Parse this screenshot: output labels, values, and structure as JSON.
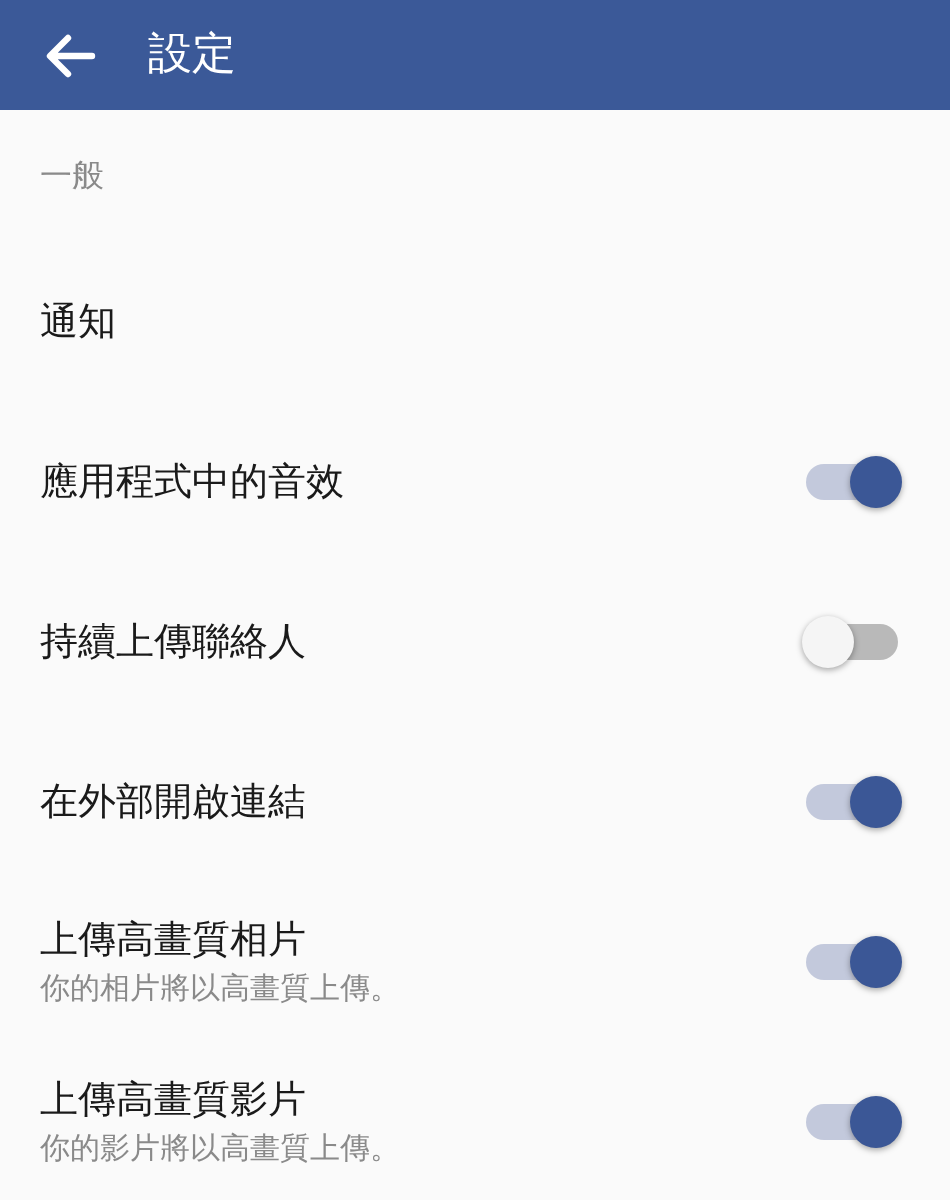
{
  "header": {
    "title": "設定"
  },
  "section": {
    "title": "一般"
  },
  "items": [
    {
      "kind": "link",
      "label": "通知"
    },
    {
      "kind": "toggle",
      "label": "應用程式中的音效",
      "on": true
    },
    {
      "kind": "toggle",
      "label": "持續上傳聯絡人",
      "on": false
    },
    {
      "kind": "toggle",
      "label": "在外部開啟連結",
      "on": true
    },
    {
      "kind": "toggle",
      "label": "上傳高畫質相片",
      "subtitle": "你的相片將以高畫質上傳。",
      "on": true
    },
    {
      "kind": "toggle",
      "label": "上傳高畫質影片",
      "subtitle": "你的影片將以高畫質上傳。",
      "on": true
    }
  ]
}
